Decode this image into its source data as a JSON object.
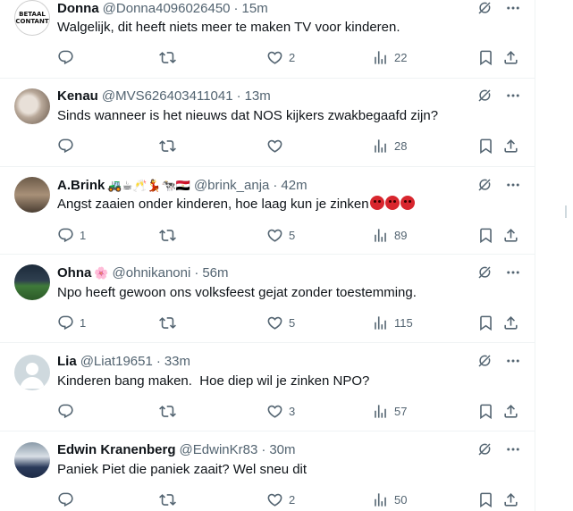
{
  "colors": {
    "text": "#0f1419",
    "muted": "#536471",
    "border": "#eff3f4",
    "angry": "#d8262e"
  },
  "tweets": [
    {
      "name": "Donna",
      "handle": "@Donna4096026450",
      "time": "15m",
      "text": "Walgelijk, dit heeft niets meer te maken TV voor kinderen.",
      "avatar_text": "BETAAL CONTANT",
      "replies": "",
      "retweets": "",
      "likes": "2",
      "views": "22"
    },
    {
      "name": "Kenau",
      "handle": "@MVS626403411041",
      "time": "13m",
      "text": "Sinds wanneer is het nieuws dat NOS kijkers zwakbegaafd zijn?",
      "replies": "",
      "retweets": "",
      "likes": "",
      "views": "28"
    },
    {
      "name": "A.Brink",
      "emoji": "🚜☕🥂💃🐄🇪🇬",
      "handle": "@brink_anja",
      "time": "42m",
      "text": "Angst zaaien onder kinderen, hoe laag kun je zinken",
      "replies": "1",
      "retweets": "",
      "likes": "5",
      "views": "89"
    },
    {
      "name": "Ohna",
      "emoji": "🌸",
      "handle": "@ohnikanoni",
      "time": "56m",
      "text": "Npo heeft gewoon ons volksfeest gejat zonder toestemming.",
      "replies": "1",
      "retweets": "",
      "likes": "5",
      "views": "115"
    },
    {
      "name": "Lia",
      "handle": "@Liat19651",
      "time": "33m",
      "text": "Kinderen bang maken.  Hoe diep wil je zinken NPO?",
      "replies": "",
      "retweets": "",
      "likes": "3",
      "views": "57"
    },
    {
      "name": "Edwin Kranenberg",
      "handle": "@EdwinKr83",
      "time": "30m",
      "text": "Paniek Piet die paniek zaait? Wel sneu dit",
      "replies": "",
      "retweets": "",
      "likes": "2",
      "views": "50"
    }
  ],
  "icons": {
    "reply": "reply-icon",
    "retweet": "retweet-icon",
    "like": "heart-icon",
    "views": "views-icon",
    "bookmark": "bookmark-icon",
    "share": "share-icon",
    "grok": "grok-icon",
    "more": "more-icon"
  }
}
